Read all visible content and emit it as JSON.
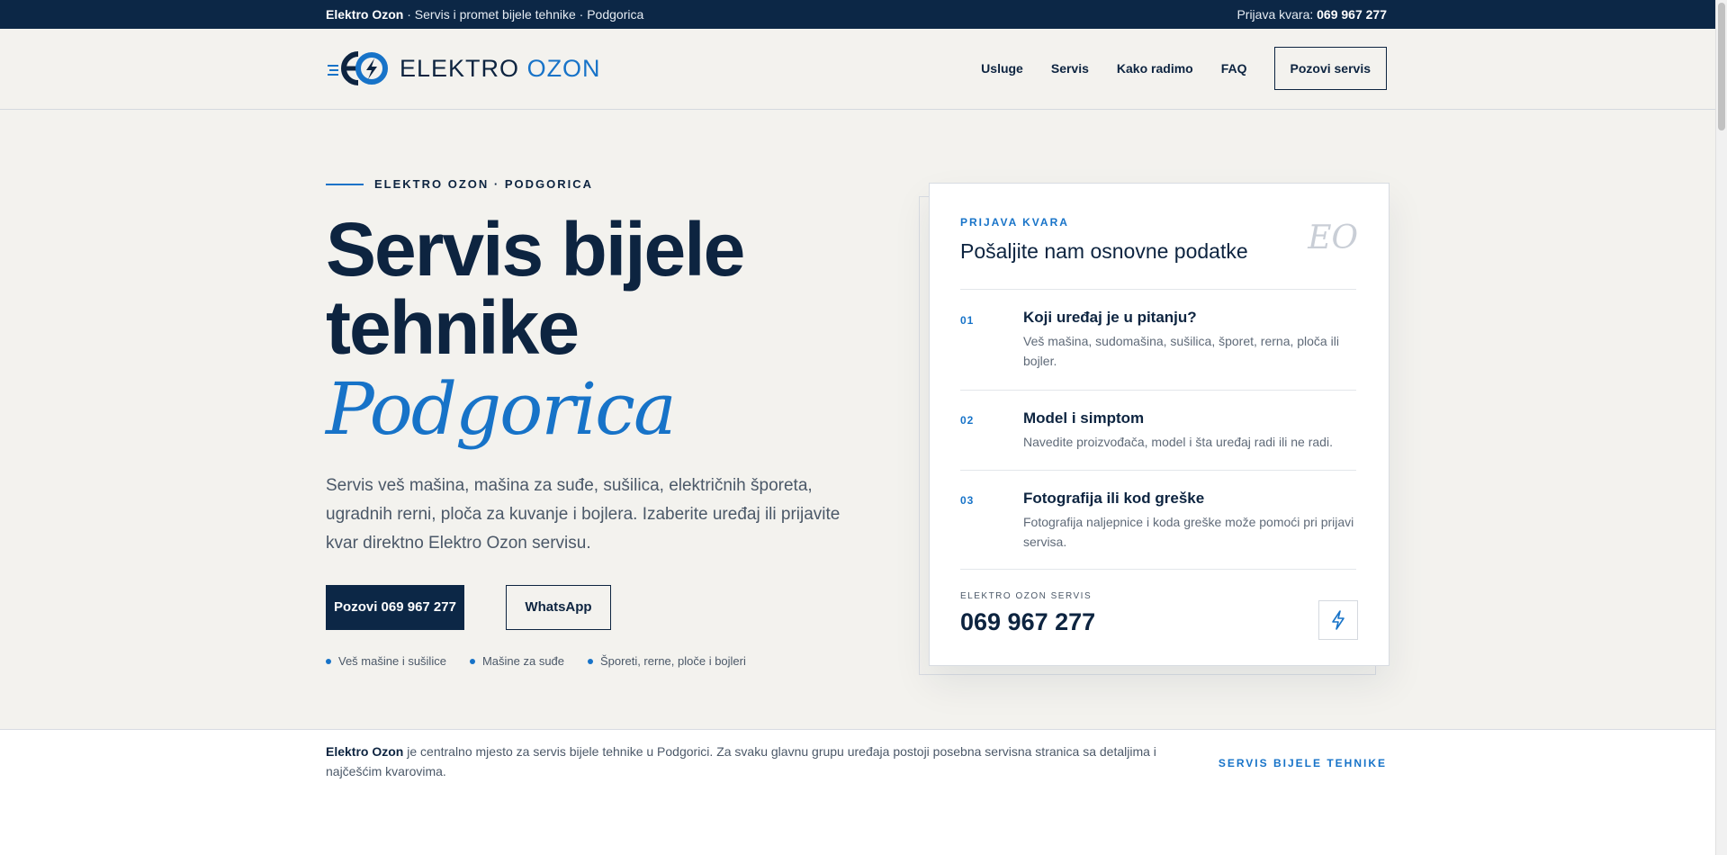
{
  "topbar": {
    "brand": "Elektro Ozon",
    "tagline": " · Servis i promet bijele tehnike · Podgorica",
    "report_label": "Prijava kvara: ",
    "report_phone": "069 967 277"
  },
  "header": {
    "logo_part1": "ELEKTRO",
    "logo_part2": "OZON",
    "nav": [
      "Usluge",
      "Servis",
      "Kako radimo",
      "FAQ"
    ],
    "cta": "Pozovi servis"
  },
  "hero": {
    "kicker": "ELEKTRO OZON · PODGORICA",
    "title_line1": "Servis bijele",
    "title_line2": "tehnike",
    "title_italic": "Podgorica",
    "lead": "Servis veš mašina, mašina za suđe, sušilica, električnih šporeta, ugradnih rerni, ploča za kuvanje i bojlera. Izaberite uređaj ili prijavite kvar direktno Elektro Ozon servisu.",
    "btn_call": "Pozovi 069 967 277",
    "btn_whatsapp": "WhatsApp",
    "tags": [
      "Veš mašine i sušilice",
      "Mašine za suđe",
      "Šporeti, rerne, ploče i bojleri"
    ]
  },
  "card": {
    "kicker": "PRIJAVA KVARA",
    "title": "Pošaljite nam osnovne podatke",
    "monogram": "EO",
    "steps": [
      {
        "num": "01",
        "title": "Koji uređaj je u pitanju?",
        "desc": "Veš mašina, sudomašina, sušilica, šporet, rerna, ploča ili bojler."
      },
      {
        "num": "02",
        "title": "Model i simptom",
        "desc": "Navedite proizvođača, model i šta uređaj radi ili ne radi."
      },
      {
        "num": "03",
        "title": "Fotografija ili kod greške",
        "desc": "Fotografija naljepnice i koda greške može pomoći pri prijavi servisa."
      }
    ],
    "footer_label": "ELEKTRO OZON SERVIS",
    "footer_phone": "069 967 277"
  },
  "strip": {
    "brand": "Elektro Ozon",
    "text": " je centralno mjesto za servis bijele tehnike u Podgorici. Za svaku glavnu grupu uređaja postoji posebna servisna stranica sa detaljima i najčešćim kvarovima.",
    "link": "SERVIS BIJELE TEHNIKE"
  },
  "colors": {
    "navy": "#0c2746",
    "accent": "#1773c8",
    "bg": "#f3f2ee"
  }
}
